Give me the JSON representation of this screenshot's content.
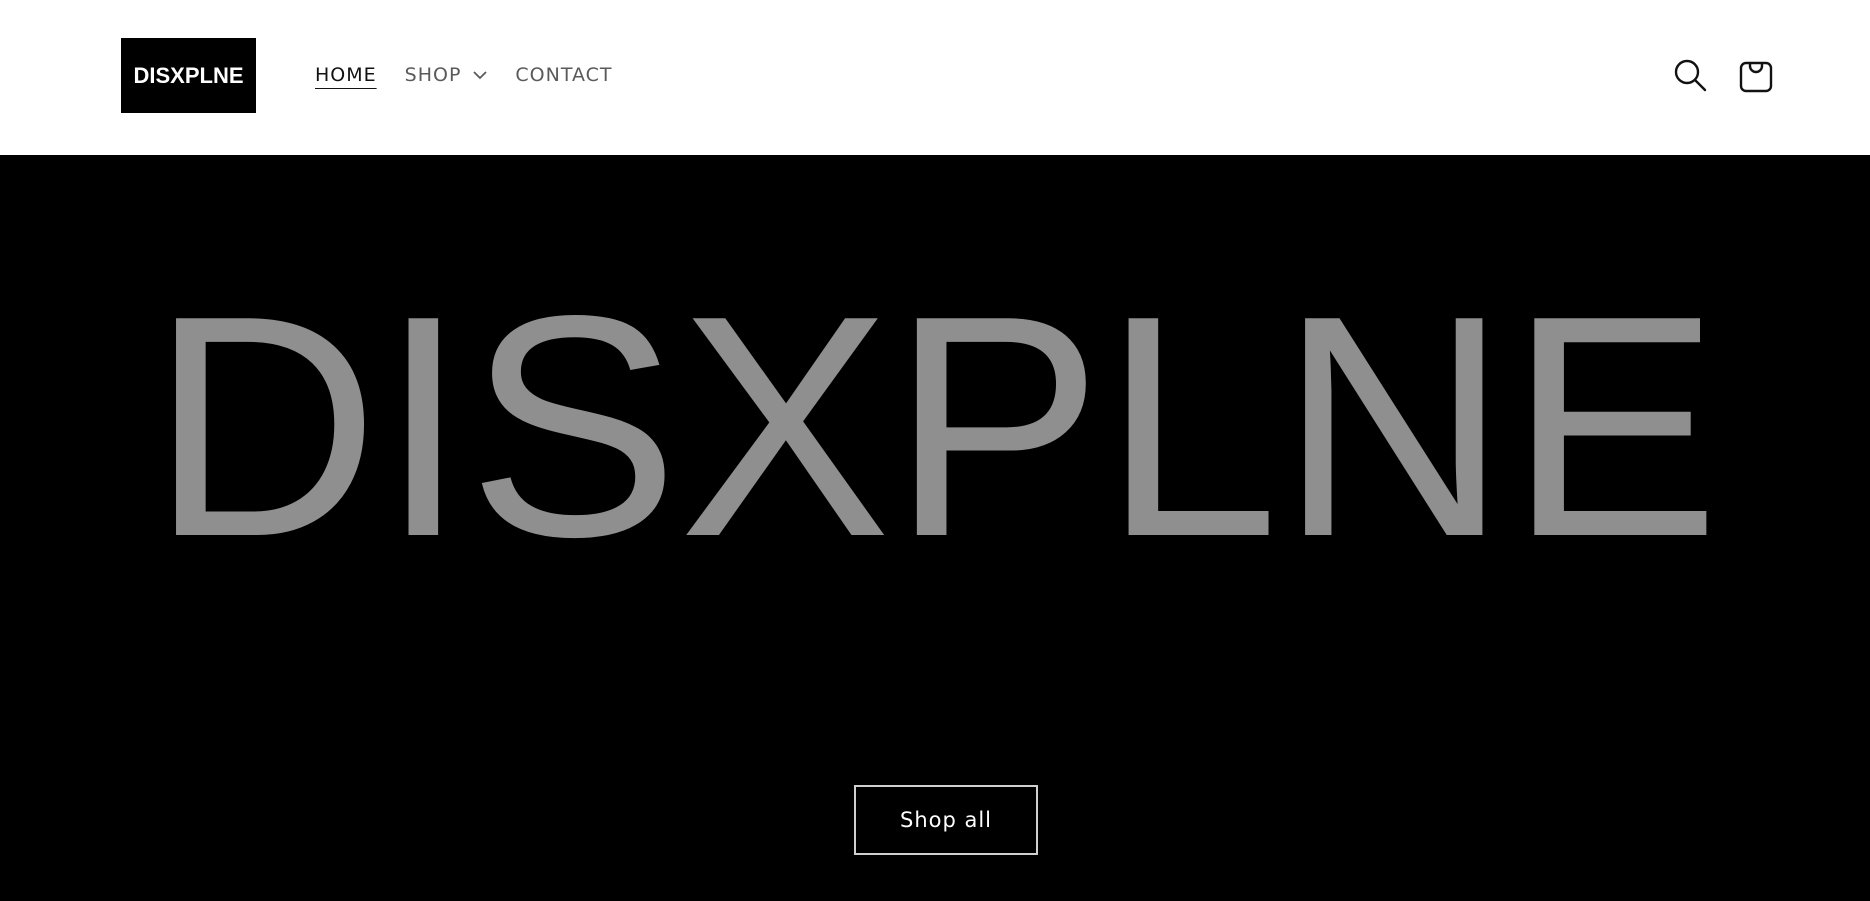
{
  "header": {
    "logo_text": "DISXPLNE",
    "nav": [
      {
        "label": "HOME",
        "active": true
      },
      {
        "label": "SHOP",
        "has_dropdown": true
      },
      {
        "label": "CONTACT"
      }
    ],
    "icons": {
      "search": "search-icon",
      "cart": "cart-icon"
    }
  },
  "hero": {
    "brand_text": "DISXPLNE",
    "brand_color": "#8f8f8f",
    "cta_label": "Shop all"
  },
  "colors": {
    "header_bg": "#ffffff",
    "hero_bg": "#000000",
    "nav_text": "#5a5a5a",
    "nav_active": "#121212"
  }
}
